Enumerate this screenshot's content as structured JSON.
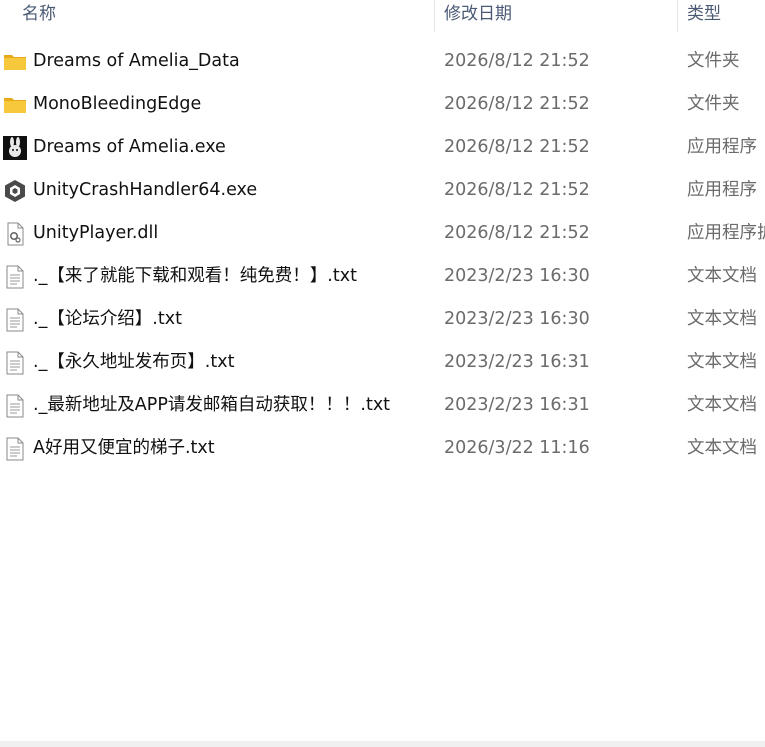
{
  "columns": {
    "name": "名称",
    "date": "修改日期",
    "type": "类型"
  },
  "files": [
    {
      "name": "Dreams of Amelia_Data",
      "date": "2026/8/12 21:52",
      "type": "文件夹",
      "icon": "folder-icon"
    },
    {
      "name": "MonoBleedingEdge",
      "date": "2026/8/12 21:52",
      "type": "文件夹",
      "icon": "folder-icon"
    },
    {
      "name": "Dreams of Amelia.exe",
      "date": "2026/8/12 21:52",
      "type": "应用程序",
      "icon": "bunny-app-icon"
    },
    {
      "name": "UnityCrashHandler64.exe",
      "date": "2026/8/12 21:52",
      "type": "应用程序",
      "icon": "unity-icon"
    },
    {
      "name": "UnityPlayer.dll",
      "date": "2026/8/12 21:52",
      "type": "应用程序扩展",
      "icon": "dll-gear-icon"
    },
    {
      "name": "._【来了就能下载和观看！纯免费！】.txt",
      "date": "2023/2/23 16:30",
      "type": "文本文档",
      "icon": "text-file-icon"
    },
    {
      "name": "._【论坛介绍】.txt",
      "date": "2023/2/23 16:30",
      "type": "文本文档",
      "icon": "text-file-icon"
    },
    {
      "name": "._【永久地址发布页】.txt",
      "date": "2023/2/23 16:31",
      "type": "文本文档",
      "icon": "text-file-icon"
    },
    {
      "name": "._最新地址及APP请发邮箱自动获取！！！.txt",
      "date": "2023/2/23 16:31",
      "type": "文本文档",
      "icon": "text-file-icon"
    },
    {
      "name": "A好用又便宜的梯子.txt",
      "date": "2026/3/22 11:16",
      "type": "文本文档",
      "icon": "text-file-icon"
    }
  ],
  "colors": {
    "folder": "#f8c83c",
    "folder_dark": "#e8a91a",
    "header_text": "#4a5a75",
    "secondary_text": "#6b6b6b"
  }
}
